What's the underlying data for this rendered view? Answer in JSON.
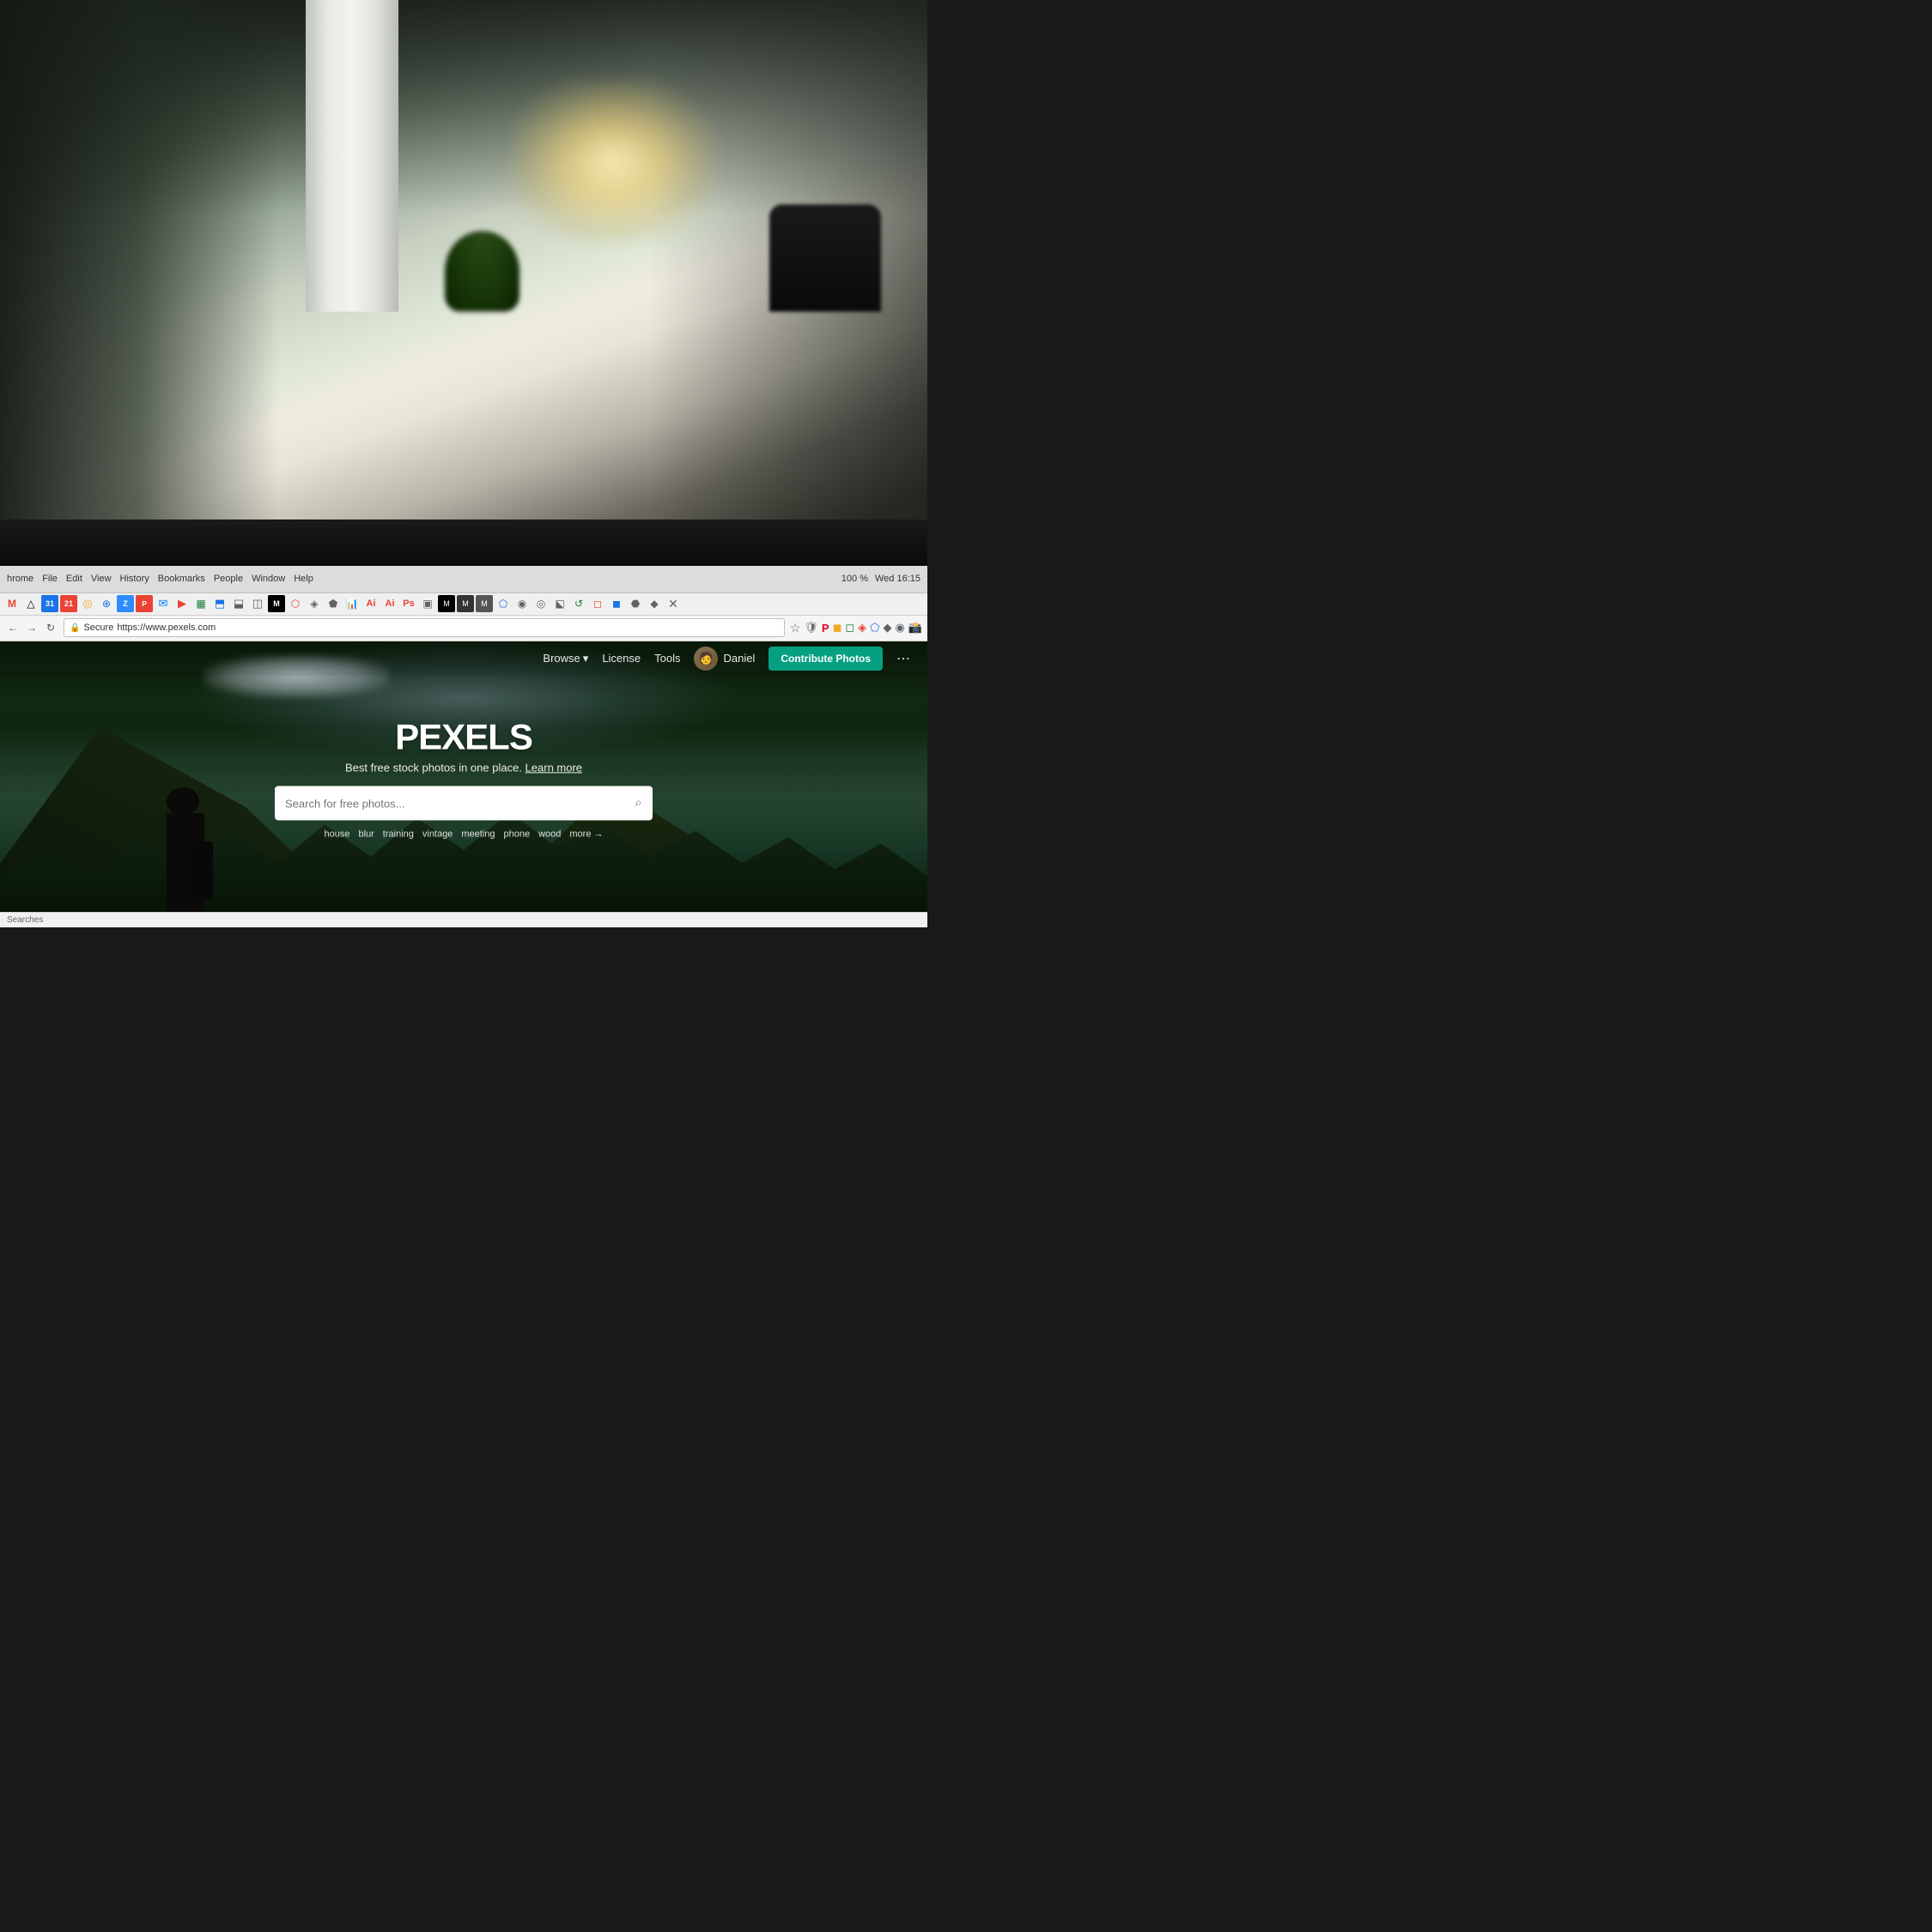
{
  "office_bg": {
    "description": "Office background photo with blurred bokeh"
  },
  "browser": {
    "title_bar": {
      "menu_items": [
        "hrome",
        "File",
        "Edit",
        "View",
        "History",
        "Bookmarks",
        "People",
        "Window",
        "Help"
      ],
      "right_info": "Wed 16:15",
      "battery": "100 %"
    },
    "nav_bar": {
      "secure_label": "Secure",
      "url": "https://www.pexels.com"
    }
  },
  "pexels": {
    "logo": "PEXELS",
    "tagline": "Best free stock photos in one place.",
    "learn_more": "Learn more",
    "search": {
      "placeholder": "Search for free photos...",
      "icon": "🔍"
    },
    "tags": [
      "house",
      "blur",
      "training",
      "vintage",
      "meeting",
      "phone",
      "wood"
    ],
    "more_label": "more →",
    "nav": {
      "browse_label": "Browse",
      "license_label": "License",
      "tools_label": "Tools",
      "user_name": "Daniel",
      "contribute_label": "Contribute Photos",
      "more_icon": "⋯"
    }
  },
  "status_bar": {
    "text": "Searches"
  },
  "icons": {
    "search": "⌕",
    "chevron_down": "▾",
    "secure_lock": "🔒",
    "star": "☆",
    "refresh": "↻",
    "back": "←",
    "forward": "→"
  }
}
